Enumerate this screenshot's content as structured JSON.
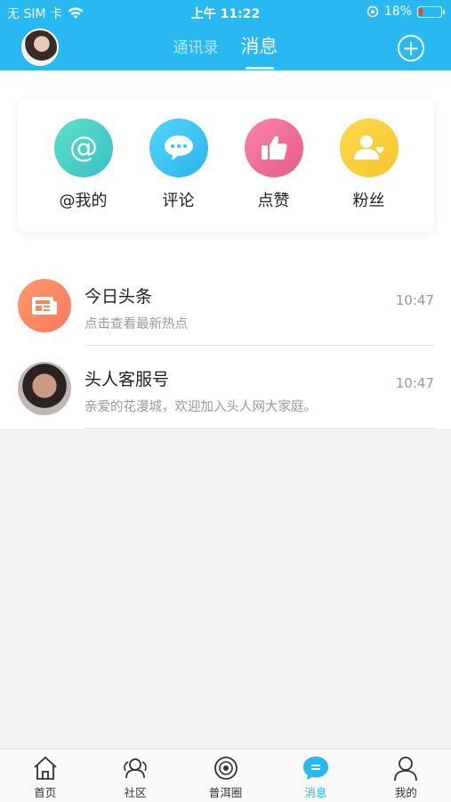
{
  "status_bar": {
    "carrier": "无 SIM 卡",
    "time": "上午 11:22",
    "battery": "18%",
    "battery_level": 0.18
  },
  "header": {
    "tabs": [
      {
        "label": "通讯录",
        "active": false
      },
      {
        "label": "消息",
        "active": true
      }
    ],
    "add_icon": "plus-circle-icon"
  },
  "shortcuts": [
    {
      "label": "@我的",
      "icon": "at-icon",
      "color": "#4dd2c3"
    },
    {
      "label": "评论",
      "icon": "comment-icon",
      "color": "#38c4f3"
    },
    {
      "label": "点赞",
      "icon": "thumbs-up-icon",
      "color": "#ef6f9a"
    },
    {
      "label": "粉丝",
      "icon": "fans-icon",
      "color": "#fbcf3a"
    }
  ],
  "messages": [
    {
      "title": "今日头条",
      "subtitle": "点击查看最新热点",
      "time": "10:47",
      "icon": "news-icon"
    },
    {
      "title": "头人客服号",
      "subtitle": "亲爱的花漫城，欢迎加入头人网大家庭。",
      "time": "10:47",
      "icon": "avatar-photo"
    }
  ],
  "bottom_nav": [
    {
      "label": "首页",
      "icon": "home-icon",
      "active": false
    },
    {
      "label": "社区",
      "icon": "community-icon",
      "active": false
    },
    {
      "label": "普洱圈",
      "icon": "circle-eye-icon",
      "active": false
    },
    {
      "label": "消息",
      "icon": "message-icon",
      "active": true
    },
    {
      "label": "我的",
      "icon": "person-icon",
      "active": false
    }
  ],
  "colors": {
    "primary": "#29b9f2",
    "background": "#f2f2f2"
  }
}
